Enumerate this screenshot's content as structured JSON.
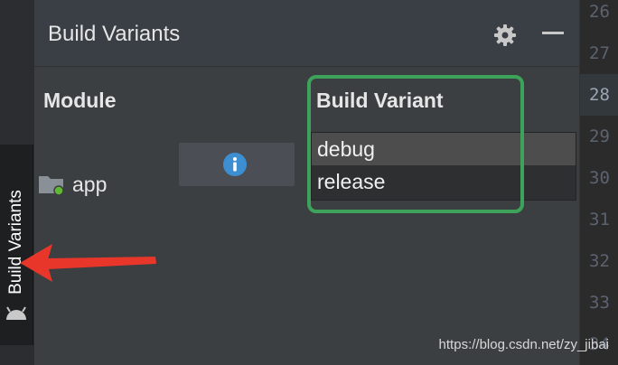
{
  "tool_strip": {
    "tab_label": "Build Variants",
    "icon": "android-icon"
  },
  "panel": {
    "title": "Build Variants",
    "header_icons": [
      "gear-icon",
      "minimize-icon"
    ],
    "columns": {
      "module": "Module",
      "build_variant": "Build Variant"
    },
    "rows": [
      {
        "module": "app",
        "module_icon": "folder-icon",
        "status_icon": "info-icon"
      }
    ],
    "variant_options": [
      {
        "label": "debug",
        "selected": true
      },
      {
        "label": "release",
        "selected": false
      }
    ]
  },
  "gutter": {
    "lines": [
      "26",
      "27",
      "28",
      "29",
      "30",
      "31",
      "32",
      "33",
      "34"
    ],
    "current_line": "28"
  },
  "watermark": "https://blog.csdn.net/zy_jibai",
  "colors": {
    "highlight_box": "#3ea35a",
    "arrow": "#e8372a",
    "info_icon": "#3d8fd1"
  }
}
